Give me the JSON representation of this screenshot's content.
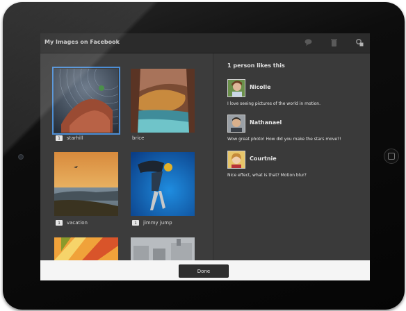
{
  "header": {
    "title": "My Images on Facebook",
    "icons": [
      "comment-icon",
      "trash-icon",
      "settings-icon"
    ]
  },
  "images": [
    {
      "label": "starhill",
      "has_comment_badge": true,
      "badge_text": "1",
      "selected": true
    },
    {
      "label": "brice",
      "has_comment_badge": false,
      "selected": false
    },
    {
      "label": "vacation",
      "has_comment_badge": true,
      "badge_text": "1",
      "selected": false
    },
    {
      "label": "jimmy jump",
      "has_comment_badge": true,
      "badge_text": "1",
      "selected": false
    }
  ],
  "right_panel": {
    "likes_text": "1 person likes this",
    "comments": [
      {
        "name": "Nicolle",
        "text": "I love seeing pictures of the world in motion."
      },
      {
        "name": "Nathanael",
        "text": "Wow great photo! How did you make the stars move?!"
      },
      {
        "name": "Courtnie",
        "text": "Nice effect, what is that? Motion blur?"
      }
    ]
  },
  "footer": {
    "done_label": "Done"
  },
  "colors": {
    "selection": "#4c8ed6",
    "panel_bg": "#3a3a3a",
    "titlebar_bg": "#2b2b2b",
    "footer_bg": "#f5f5f5"
  }
}
